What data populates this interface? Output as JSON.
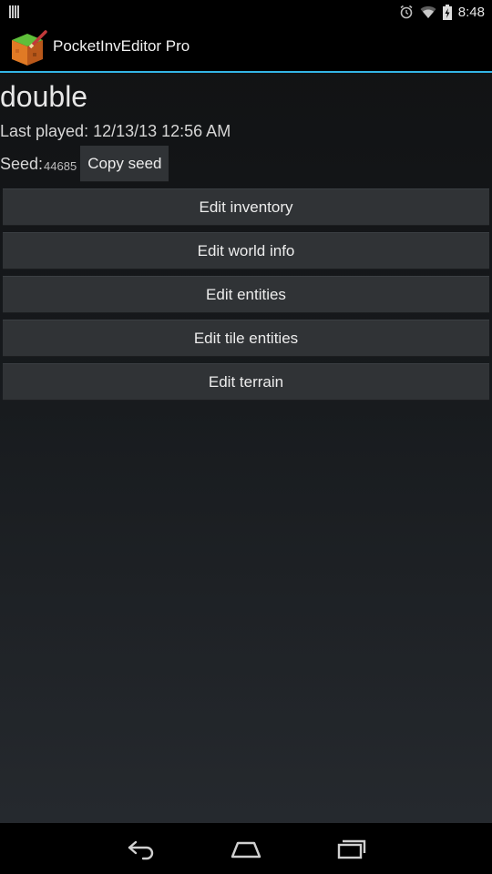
{
  "status_bar": {
    "time": "8:48",
    "icons": [
      "notification-icon",
      "alarm-icon",
      "wifi-icon",
      "battery-icon"
    ]
  },
  "action_bar": {
    "title": "PocketInvEditor Pro",
    "icon": "app-icon",
    "accent_color": "#33b5e5"
  },
  "world": {
    "name": "double",
    "last_played": "Last played: 12/13/13 12:56 AM",
    "seed_label": "Seed:",
    "seed_value": "44685",
    "copy_seed_label": "Copy seed"
  },
  "menu": {
    "items": [
      {
        "label": "Edit inventory"
      },
      {
        "label": "Edit world info"
      },
      {
        "label": "Edit entities"
      },
      {
        "label": "Edit tile entities"
      },
      {
        "label": "Edit terrain"
      }
    ]
  },
  "nav_bar": {
    "items": [
      "back-icon",
      "home-icon",
      "recent-apps-icon"
    ]
  }
}
